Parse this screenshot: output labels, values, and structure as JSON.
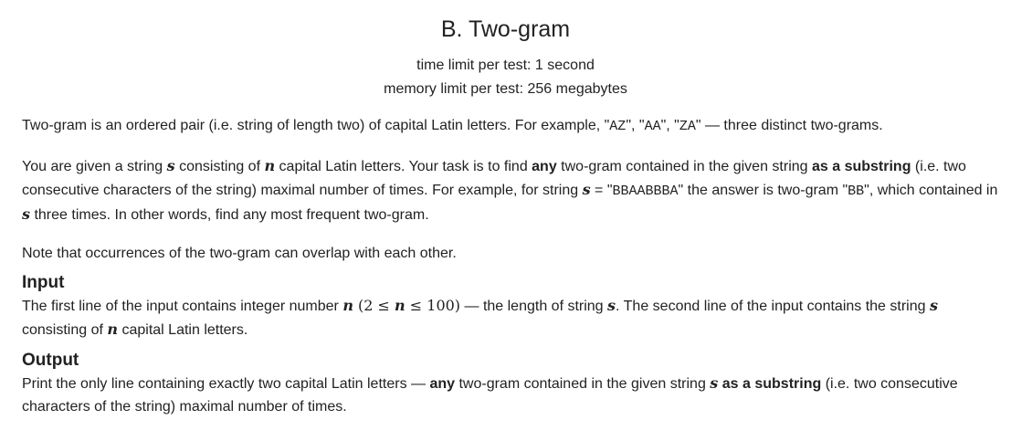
{
  "header": {
    "title": "B. Two-gram",
    "time_limit": "time limit per test: 1 second",
    "memory_limit": "memory limit per test: 256 megabytes"
  },
  "statement": {
    "p1": {
      "t1": "Two-gram is an ordered pair (i.e. string of length two) of capital Latin letters. For example, \"",
      "c1": "AZ",
      "t2": "\", \"",
      "c2": "AA",
      "t3": "\", \"",
      "c3": "ZA",
      "t4": "\" — three distinct two-grams."
    },
    "p2": {
      "t1": "You are given a string ",
      "s1": "s",
      "t2": " consisting of ",
      "n1": "n",
      "t3": " capital Latin letters. Your task is to find ",
      "b1": "any",
      "t4": " two-gram contained in the given string ",
      "b2": "as a substring",
      "t5": " (i.e. two consecutive characters of the string) maximal number of times. For example, for string ",
      "s2": "s",
      "t6": " = \"",
      "c1": "BBAABBBA",
      "t7": "\" the answer is two-gram \"",
      "c2": "BB",
      "t8": "\", which contained in ",
      "s3": "s",
      "t9": " three times. In other words, find any most frequent two-gram."
    },
    "p3": "Note that occurrences of the two-gram can overlap with each other."
  },
  "input": {
    "title": "Input",
    "t1": "The first line of the input contains integer number ",
    "n1": "n",
    "m1": " (2 ≤ ",
    "n2": "n",
    "m2": " ≤ 100)",
    "t2": " — the length of string ",
    "s1": "s",
    "t3": ". The second line of the input contains the string ",
    "s2": "s",
    "t4": " consisting of ",
    "n3": "n",
    "t5": " capital Latin letters."
  },
  "output": {
    "title": "Output",
    "t1": "Print the only line containing exactly two capital Latin letters — ",
    "b1": "any",
    "t2": " two-gram contained in the given string ",
    "s1": "s",
    "t3": " ",
    "b2": "as a substring",
    "t4": " (i.e. two consecutive characters of the string) maximal number of times."
  }
}
